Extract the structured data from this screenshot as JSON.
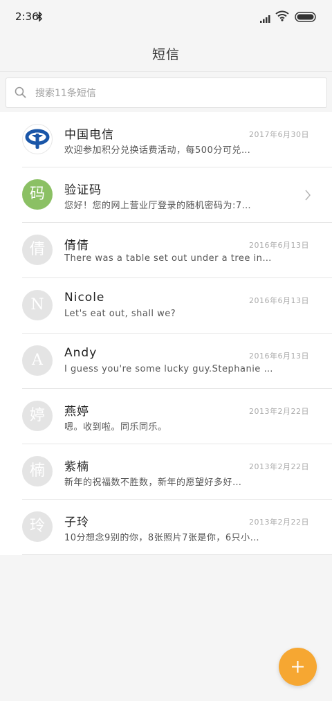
{
  "status_bar": {
    "time": "2:36"
  },
  "header": {
    "title": "短信"
  },
  "search": {
    "placeholder": "搜索11条短信"
  },
  "conversations": [
    {
      "avatar": "",
      "avatar_type": "china-telecom-logo",
      "name": "中国电信",
      "snippet": "欢迎参加积分兑换话费活动，每500分可兑…",
      "date": "2017年6月30日"
    },
    {
      "avatar": "码",
      "avatar_type": "green",
      "name": "验证码",
      "snippet": "您好！您的网上营业厅登录的随机密码为:7…",
      "date": "",
      "has_chevron": true
    },
    {
      "avatar": "倩",
      "avatar_type": "grey",
      "name": "倩倩",
      "snippet": "There was a table set out under a tree in…",
      "date": "2016年6月13日"
    },
    {
      "avatar": "N",
      "avatar_type": "grey",
      "name": "Nicole",
      "snippet": "Let's eat out, shall we?",
      "date": "2016年6月13日"
    },
    {
      "avatar": "A",
      "avatar_type": "grey",
      "name": "Andy",
      "snippet": "I guess you're some lucky guy.Stephanie …",
      "date": "2016年6月13日"
    },
    {
      "avatar": "婷",
      "avatar_type": "grey",
      "name": "燕婷",
      "snippet": "嗯。收到啦。同乐同乐。",
      "date": "2013年2月22日"
    },
    {
      "avatar": "楠",
      "avatar_type": "grey",
      "name": "紫楠",
      "snippet": "新年的祝福数不胜数，新年的愿望好多好…",
      "date": "2013年2月22日"
    },
    {
      "avatar": "玲",
      "avatar_type": "grey",
      "name": "子玲",
      "snippet": "10分想念9别的你，8张照片7张是你，6只小…",
      "date": "2013年2月22日"
    }
  ],
  "icons": {
    "bluetooth": "bluetooth-icon",
    "signal": "signal-icon",
    "wifi": "wifi-icon",
    "battery": "battery-icon",
    "search": "search-icon",
    "chevron": "chevron-right-icon",
    "fab": "plus-icon"
  },
  "colors": {
    "fab": "#f6a732",
    "verification_avatar": "#8bc064",
    "default_avatar": "#e4e4e4",
    "telecom_blue": "#1a56a8"
  }
}
